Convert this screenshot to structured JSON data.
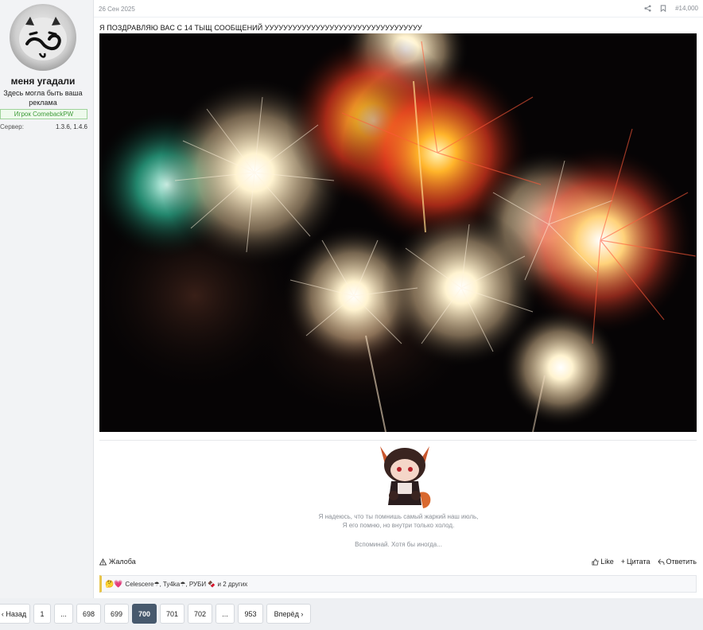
{
  "user": {
    "name": "меня угадали",
    "title": "Здесь могла быть ваша реклама",
    "banner": "Игрок ComebackPW",
    "server_label": "Сервер:",
    "server_value": "1.3.6, 1.4.6"
  },
  "post": {
    "date": "26 Сен 2025",
    "number": "#14,000",
    "text": "Я ПОЗДРАВЛЯЮ ВАС С 14 ТЫЩ СООБЩЕНИЙ УУУУУУУУУУУУУУУУУУУУУУУУУУУУУУУУУУ",
    "icons": [
      "share-icon",
      "bookmark-icon"
    ],
    "signature": {
      "line1": "Я надеюсь, что ты помнишь самый жаркий наш июль,",
      "line2": "Я его помню, но внутри только холод.",
      "line3": "Вспоминай. Хотя бы иногда..."
    },
    "report_label": "Жалоба",
    "like_label": "Like",
    "quote_label": "Цитата",
    "reply_label": "Ответить"
  },
  "reactions": {
    "emojis": "🤔💗",
    "text": "Celescere☂, Ty4ka☂, РУБИ 🍫 и 2 других"
  },
  "pagination": {
    "prev": "Назад",
    "next": "Вперёд",
    "pages": [
      "1",
      "...",
      "698",
      "699",
      "700",
      "701",
      "702",
      "...",
      "953"
    ],
    "current": "700"
  },
  "colors": {
    "accent": "#47596d",
    "banner_green": "#3e9b39",
    "reaction_border": "#e8c44a"
  }
}
